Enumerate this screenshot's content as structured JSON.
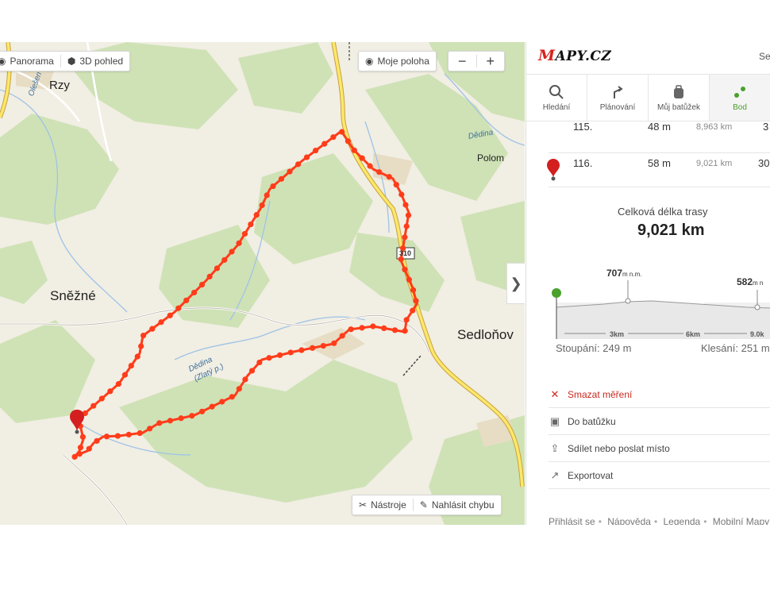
{
  "map": {
    "controls": {
      "panorama": "Panorama",
      "view3d": "3D pohled",
      "my_location": "Moje poloha",
      "zoom_out": "−",
      "zoom_in": "+",
      "tools": "Nástroje",
      "report_error": "Nahlásit chybu"
    },
    "labels": {
      "rzy": "Rzy",
      "snezne": "Sněžné",
      "sedlonov": "Sedloňov",
      "polom": "Polom",
      "dedina": "Dědina",
      "dedina_zlaty": "Dědina",
      "zlaty": "(Zlatý p.)",
      "olesenka": "Olešen",
      "road_310": "310"
    },
    "collapse_arrow": "❯",
    "route_color": "#ff3c1a"
  },
  "panel": {
    "logo_m": "M",
    "logo_rest": "APY.CZ",
    "top_right": "Se",
    "tabs": [
      {
        "label": "Hledání",
        "icon": "search-icon"
      },
      {
        "label": "Plánování",
        "icon": "route-icon"
      },
      {
        "label": "Můj batůžek",
        "icon": "backpack-icon"
      },
      {
        "label": "Bod",
        "icon": "points-icon"
      }
    ],
    "points": [
      {
        "index": "115.",
        "segment": "48 m",
        "total": "8,963 km",
        "extra": "3"
      },
      {
        "index": "116.",
        "segment": "58 m",
        "total": "9,021 km",
        "extra": "30"
      }
    ],
    "summary_label": "Celková délka trasy",
    "summary_value": "9,021 km",
    "profile": {
      "max_elev": "707",
      "max_unit": "m n.m.",
      "min_elev": "582",
      "min_unit": "m n",
      "ticks": [
        "3km",
        "6km",
        "9.0k"
      ]
    },
    "climb": "Stoupání: 249 m",
    "descent": "Klesání: 251 m",
    "actions": [
      {
        "label": "Smazat měření",
        "icon": "close-icon"
      },
      {
        "label": "Do batůžku",
        "icon": "backpack-icon"
      },
      {
        "label": "Sdílet nebo poslat místo",
        "icon": "share-icon"
      },
      {
        "label": "Exportovat",
        "icon": "export-icon"
      }
    ],
    "footer": [
      "Přihlásit se",
      "Nápověda",
      "Legenda",
      "Mobilní Mapy"
    ]
  }
}
